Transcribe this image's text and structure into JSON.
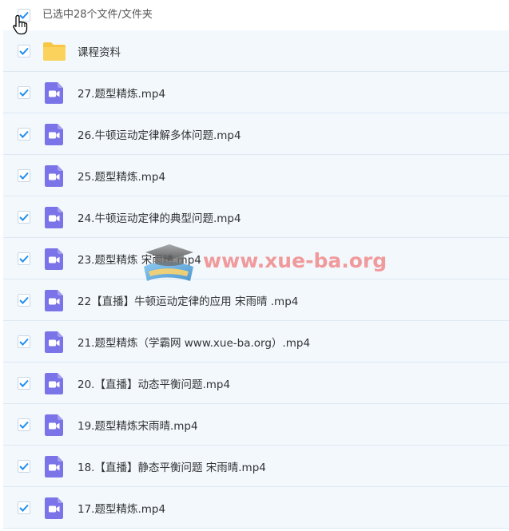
{
  "header": {
    "selection_label": "已选中28个文件/文件夹"
  },
  "colors": {
    "check_blue": "#1f8ff0",
    "row_background": "#f3f8fd",
    "video_icon": "#7b74e8",
    "folder_icon": "#f7c644"
  },
  "files": [
    {
      "name": "课程资料",
      "type": "folder",
      "selected": true
    },
    {
      "name": "27.题型精炼.mp4",
      "type": "video",
      "selected": true
    },
    {
      "name": "26.牛顿运动定律解多体问题.mp4",
      "type": "video",
      "selected": true
    },
    {
      "name": "25.题型精炼.mp4",
      "type": "video",
      "selected": true
    },
    {
      "name": "24.牛顿运动定律的典型问题.mp4",
      "type": "video",
      "selected": true
    },
    {
      "name": "23.题型精炼 宋雨晴.mp4",
      "type": "video",
      "selected": true
    },
    {
      "name": "22【直播】牛顿运动定律的应用 宋雨晴 .mp4",
      "type": "video",
      "selected": true
    },
    {
      "name": "21.题型精炼（学霸网 www.xue-ba.org）.mp4",
      "type": "video",
      "selected": true
    },
    {
      "name": "20.【直播】动态平衡问题.mp4",
      "type": "video",
      "selected": true
    },
    {
      "name": "19.题型精炼宋雨晴.mp4",
      "type": "video",
      "selected": true
    },
    {
      "name": "18.【直播】静态平衡问题 宋雨晴.mp4",
      "type": "video",
      "selected": true
    },
    {
      "name": "17.题型精炼.mp4",
      "type": "video",
      "selected": true
    }
  ],
  "watermark": {
    "text": "www.xue-ba.org"
  }
}
